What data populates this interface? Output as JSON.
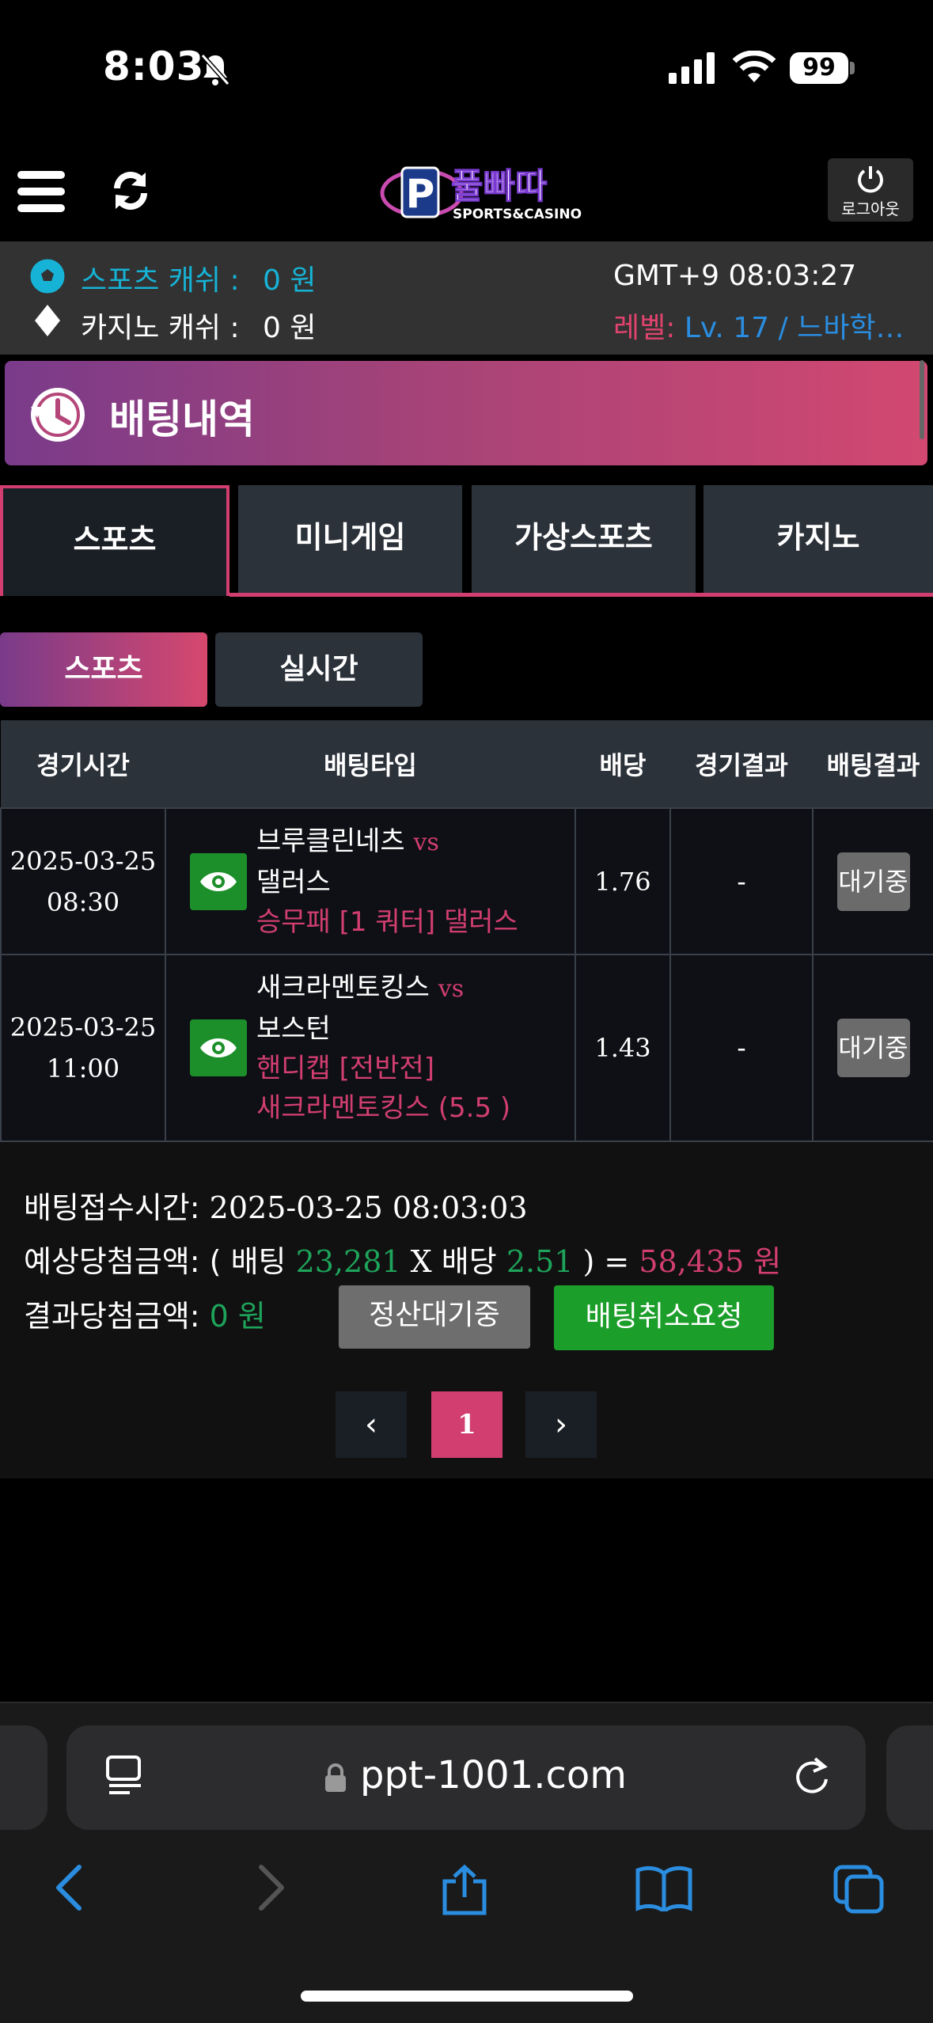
{
  "status_bar": {
    "time": "8:03",
    "battery": "99"
  },
  "header": {
    "logo_main": "풀빠따",
    "logo_sub": "SPORTS&CASINO",
    "logout_label": "로그아웃"
  },
  "info": {
    "sports_cash_label": "스포츠 캐쉬 :",
    "sports_cash_value": "0 원",
    "casino_cash_label": "카지노 캐쉬 :",
    "casino_cash_value": "0 원",
    "clock": "GMT+9 08:03:27",
    "level_label": "레벨:",
    "level_value": "Lv. 17 / 느바학…"
  },
  "page_title": "배팅내역",
  "main_tabs": [
    {
      "label": "스포츠",
      "active": true
    },
    {
      "label": "미니게임",
      "active": false
    },
    {
      "label": "가상스포츠",
      "active": false
    },
    {
      "label": "카지노",
      "active": false
    }
  ],
  "sub_tabs": [
    {
      "label": "스포츠",
      "active": true
    },
    {
      "label": "실시간",
      "active": false
    }
  ],
  "table": {
    "headers": [
      "경기시간",
      "배팅타입",
      "배당",
      "경기결과",
      "배팅결과"
    ],
    "rows": [
      {
        "date": "2025-03-25",
        "time": "08:30",
        "home": "브루클린네츠",
        "vs": "vs",
        "away": "댈러스",
        "bet_line1": "승무패 [1 쿼터] 댈러스",
        "bet_line2": "",
        "odds": "1.76",
        "result": "-",
        "status": "대기중"
      },
      {
        "date": "2025-03-25",
        "time": "11:00",
        "home": "새크라멘토킹스",
        "vs": "vs",
        "away": "보스턴",
        "bet_line1": "핸디캡 [전반전]",
        "bet_line2": "새크라멘토킹스 (5.5 )",
        "odds": "1.43",
        "result": "-",
        "status": "대기중"
      }
    ]
  },
  "summary": {
    "bet_time_label": "배팅접수시간:",
    "bet_time_value": "2025-03-25 08:03:03",
    "expected_label": "예상당첨금액:",
    "expected_open": "( 배팅",
    "expected_stake": "23,281",
    "expected_x": "X 배당",
    "expected_odds": "2.51",
    "expected_close": ") =",
    "expected_amount": "58,435 원",
    "result_label": "결과당첨금액:",
    "result_amount": "0 원",
    "settle_button": "정산대기중",
    "cancel_button": "배팅취소요청"
  },
  "pagination": {
    "prev": "‹",
    "current": "1",
    "next": "›"
  },
  "browser": {
    "url": "ppt-1001.com"
  },
  "colors": {
    "accent": "#d13e6f",
    "cyan": "#16b3d6",
    "green": "#1c9e2a",
    "blue": "#2a8de0"
  }
}
